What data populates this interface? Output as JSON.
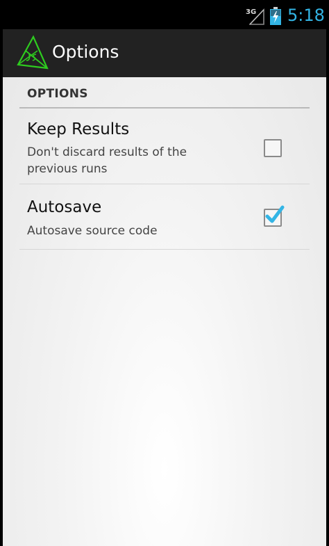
{
  "status_bar": {
    "network_label": "3G",
    "time": "5:18",
    "time_color": "#33b5e5",
    "icons": [
      "signal-icon",
      "battery-charging-icon"
    ]
  },
  "action_bar": {
    "title": "Options",
    "logo_icon": "js-triangle-logo-icon",
    "logo_color": "#2ecc1f"
  },
  "preferences": {
    "section_header": "OPTIONS",
    "items": [
      {
        "title": "Keep Results",
        "summary": "Don't discard results of the previous runs",
        "checked": false
      },
      {
        "title": "Autosave",
        "summary": "Autosave source code",
        "checked": true
      }
    ],
    "check_color": "#33b5e5"
  }
}
